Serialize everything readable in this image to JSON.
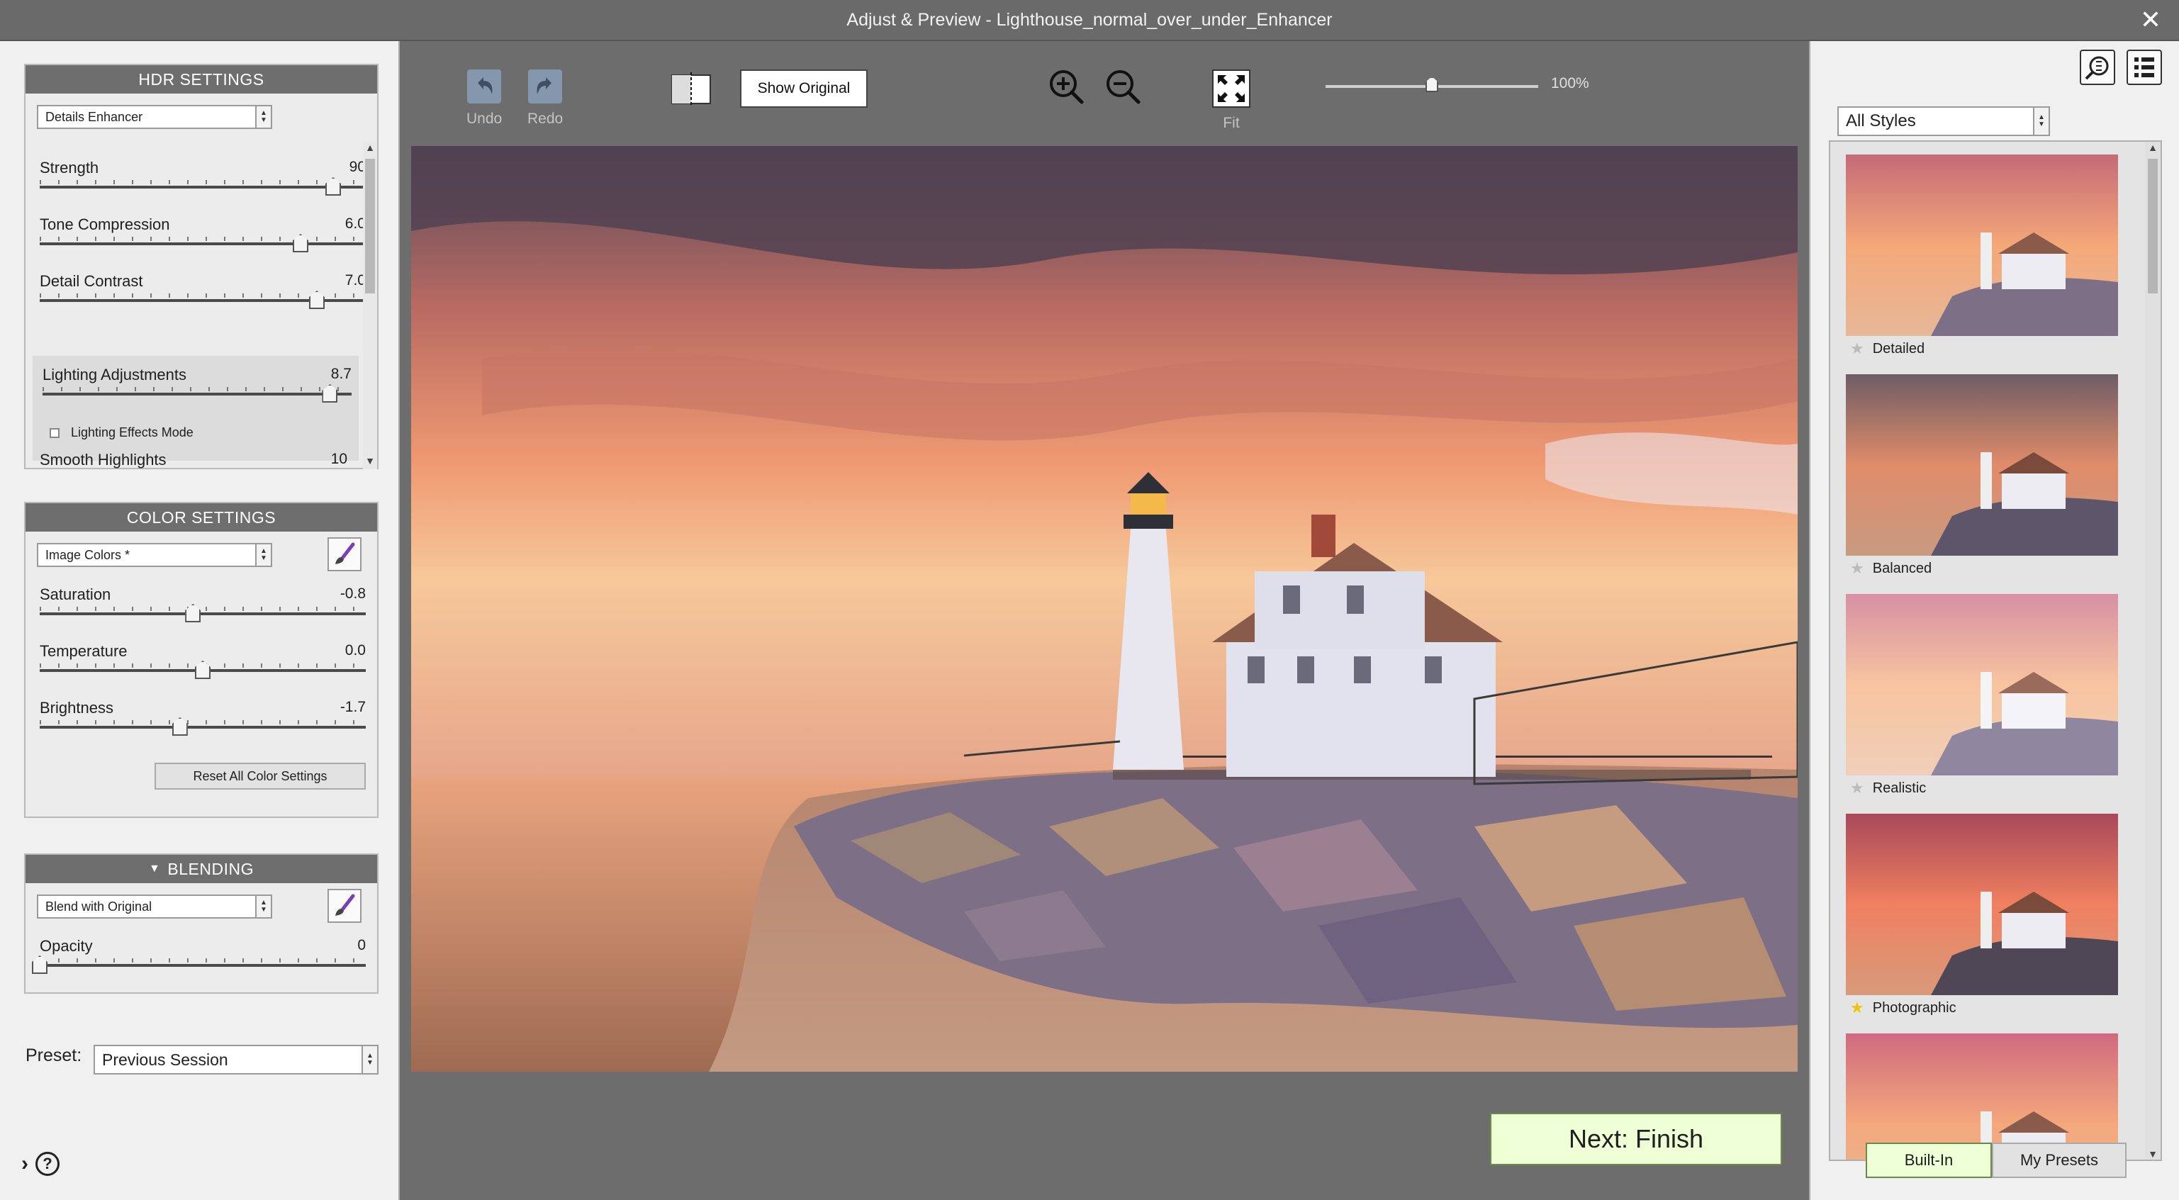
{
  "window": {
    "title": "Adjust & Preview - Lighthouse_normal_over_under_Enhancer",
    "close_glyph": "✕"
  },
  "hdr": {
    "header": "HDR SETTINGS",
    "method": "Details Enhancer",
    "sliders": [
      {
        "label": "Strength",
        "value": "90",
        "level": 0.9
      },
      {
        "label": "Tone Compression",
        "value": "6.0",
        "level": 0.8
      },
      {
        "label": "Detail Contrast",
        "value": "7.0",
        "level": 0.85
      }
    ],
    "lighting": {
      "label": "Lighting Adjustments",
      "value": "8.7",
      "level": 0.93,
      "checkbox_label": "Lighting Effects Mode",
      "checked": false
    },
    "smooth": {
      "label": "Smooth Highlights",
      "value": "10"
    }
  },
  "color": {
    "header": "COLOR SETTINGS",
    "mode": "Image Colors *",
    "sliders": [
      {
        "label": "Saturation",
        "value": "-0.8",
        "level": 0.47
      },
      {
        "label": "Temperature",
        "value": "0.0",
        "level": 0.5
      },
      {
        "label": "Brightness",
        "value": "-1.7",
        "level": 0.43
      }
    ],
    "reset_label": "Reset All Color Settings"
  },
  "blending": {
    "header": "BLENDING",
    "mode": "Blend with Original",
    "opacity_label": "Opacity",
    "opacity_value": "0",
    "opacity_level": 0.0
  },
  "preset": {
    "label": "Preset:",
    "value": "Previous Session"
  },
  "help": {
    "expand_glyph": "›",
    "q": "?"
  },
  "toolbar": {
    "undo": "Undo",
    "redo": "Redo",
    "show_original": "Show Original",
    "fit": "Fit",
    "zoom_pct": "100%",
    "zoom_level": 0.5
  },
  "next_button": "Next: Finish",
  "styles": {
    "filter": "All Styles",
    "items": [
      {
        "name": "Detailed",
        "favorite": false
      },
      {
        "name": "Balanced",
        "favorite": false
      },
      {
        "name": "Realistic",
        "favorite": false
      },
      {
        "name": "Photographic",
        "favorite": true
      },
      {
        "name": "",
        "favorite": false
      }
    ],
    "tab_builtin": "Built-In",
    "tab_mypresets": "My Presets"
  },
  "colors": {
    "accent_next": "#efffd6",
    "panel_header": "#6e6e6e",
    "favorite_star": "#f0c400"
  }
}
